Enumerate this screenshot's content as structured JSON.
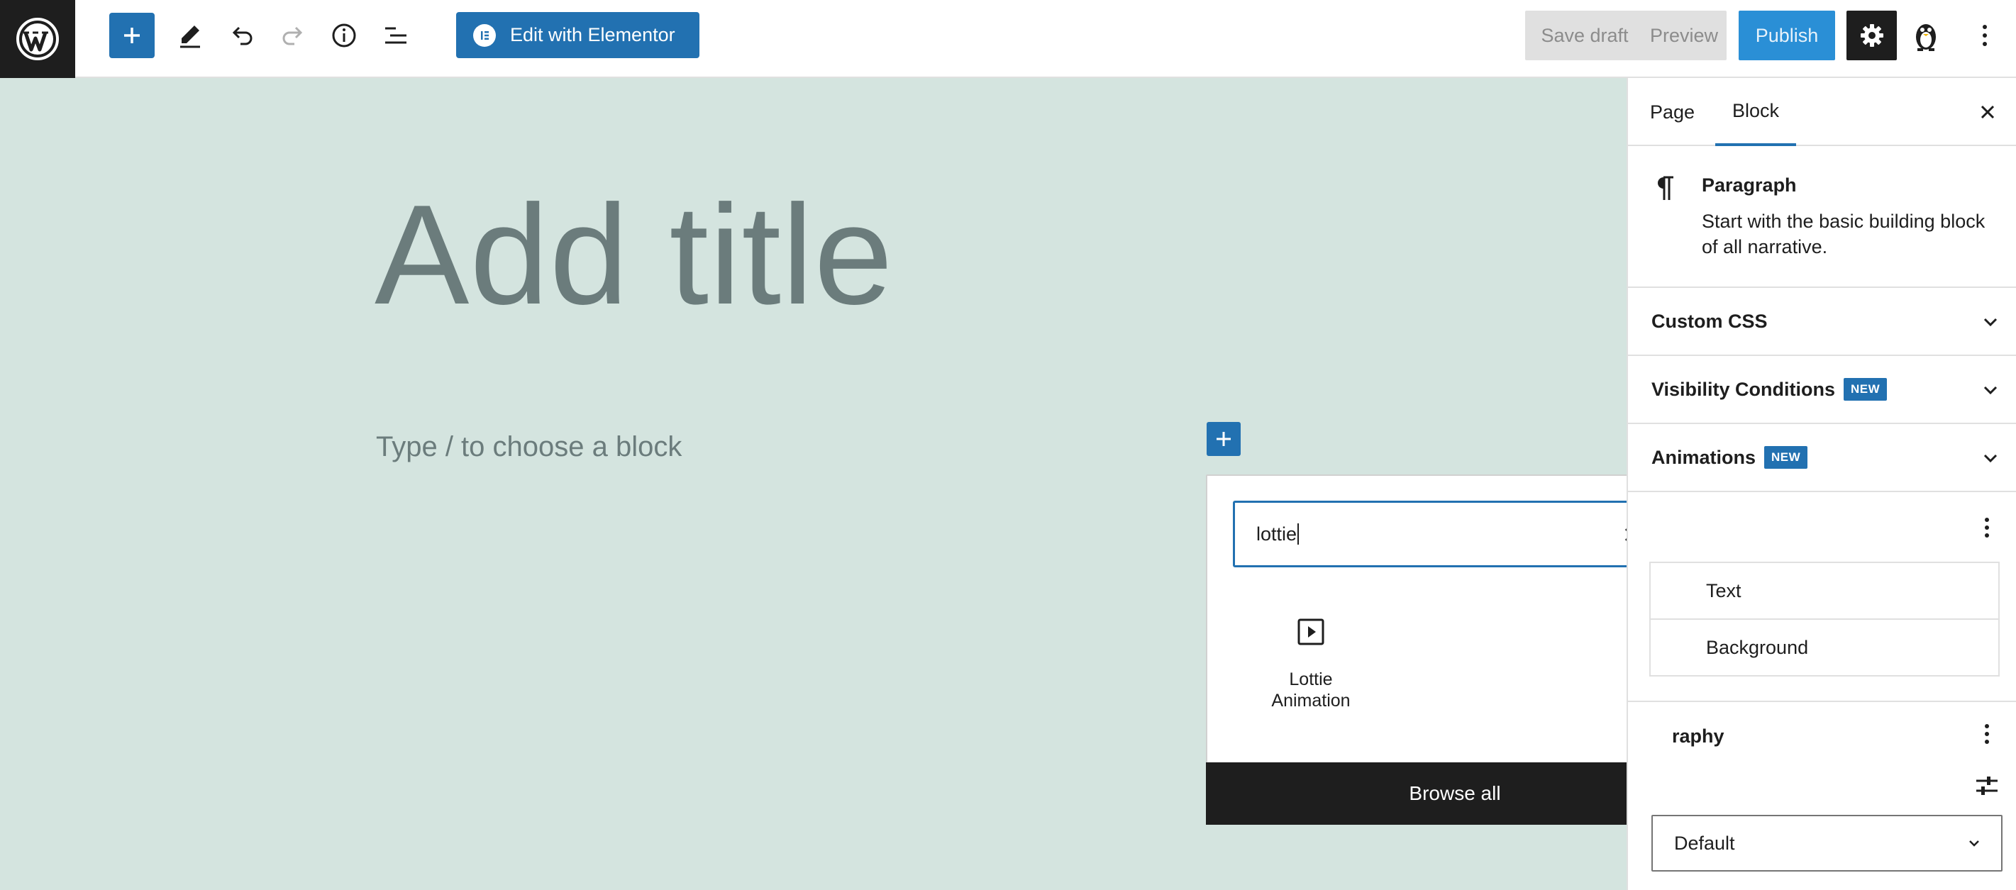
{
  "toolbar": {
    "elementor_label": "Edit with Elementor",
    "save_draft_label": "Save draft",
    "preview_label": "Preview",
    "publish_label": "Publish"
  },
  "editor": {
    "title_placeholder": "Add title",
    "block_placeholder": "Type / to choose a block"
  },
  "inserter": {
    "search_value": "lottie",
    "results": [
      {
        "label_line1": "Lottie",
        "label_line2": "Animation",
        "icon": "play-icon"
      }
    ],
    "browse_all_label": "Browse all"
  },
  "sidebar": {
    "tabs": {
      "page": "Page",
      "block": "Block"
    },
    "block_card": {
      "title": "Paragraph",
      "description": "Start with the basic building block of all narrative."
    },
    "panels": {
      "custom_css": "Custom CSS",
      "visibility": "Visibility Conditions",
      "animations": "Animations",
      "new_badge": "NEW"
    },
    "color": {
      "text_label": "Text",
      "background_label": "Background"
    },
    "typography": {
      "label_visible": "raphy",
      "select_value": "Default"
    }
  },
  "colors": {
    "accent": "#2271b1",
    "canvas_bg": "#d4e4df",
    "dark": "#1e1e1e"
  }
}
